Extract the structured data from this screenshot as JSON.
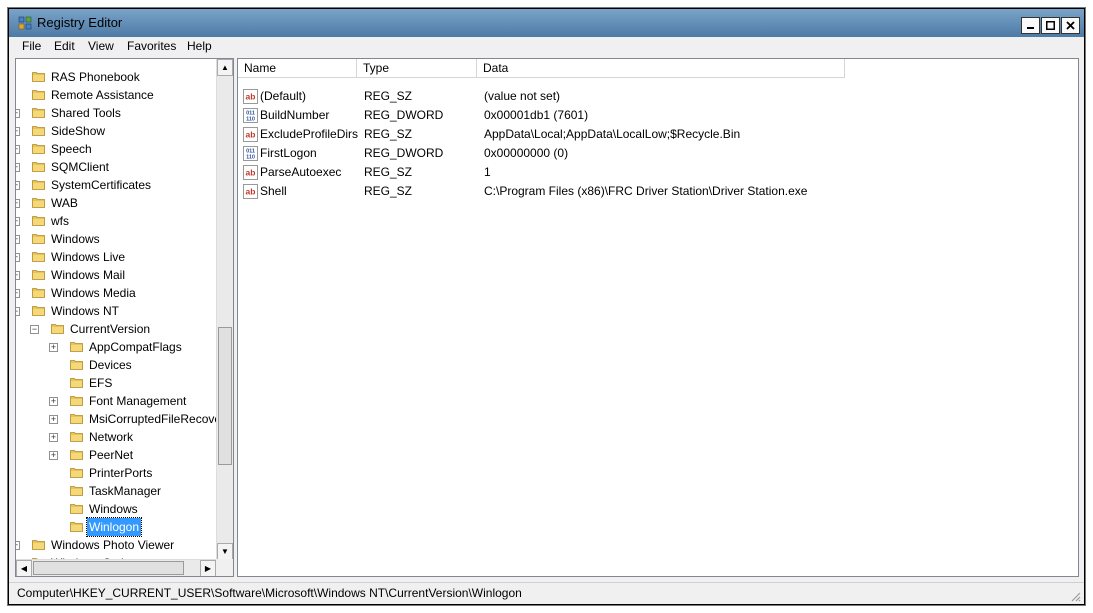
{
  "window": {
    "title": "Registry Editor"
  },
  "menu": [
    {
      "label": "File"
    },
    {
      "label": "Edit"
    },
    {
      "label": "View"
    },
    {
      "label": "Favorites"
    },
    {
      "label": "Help"
    }
  ],
  "tree": {
    "items": [
      {
        "label": "RAS Phonebook",
        "level": 1,
        "expander": ""
      },
      {
        "label": "Remote Assistance",
        "level": 1,
        "expander": ""
      },
      {
        "label": "Shared Tools",
        "level": 1,
        "expander": "plus"
      },
      {
        "label": "SideShow",
        "level": 1,
        "expander": "plus"
      },
      {
        "label": "Speech",
        "level": 1,
        "expander": "plus"
      },
      {
        "label": "SQMClient",
        "level": 1,
        "expander": "plus"
      },
      {
        "label": "SystemCertificates",
        "level": 1,
        "expander": "plus"
      },
      {
        "label": "WAB",
        "level": 1,
        "expander": "plus"
      },
      {
        "label": "wfs",
        "level": 1,
        "expander": "plus"
      },
      {
        "label": "Windows",
        "level": 1,
        "expander": "plus"
      },
      {
        "label": "Windows Live",
        "level": 1,
        "expander": "plus"
      },
      {
        "label": "Windows Mail",
        "level": 1,
        "expander": "plus"
      },
      {
        "label": "Windows Media",
        "level": 1,
        "expander": "plus"
      },
      {
        "label": "Windows NT",
        "level": 1,
        "expander": "minus"
      },
      {
        "label": "CurrentVersion",
        "level": 2,
        "expander": "minus"
      },
      {
        "label": "AppCompatFlags",
        "level": 3,
        "expander": "plus"
      },
      {
        "label": "Devices",
        "level": 3,
        "expander": ""
      },
      {
        "label": "EFS",
        "level": 3,
        "expander": ""
      },
      {
        "label": "Font Management",
        "level": 3,
        "expander": "plus"
      },
      {
        "label": "MsiCorruptedFileRecove",
        "level": 3,
        "expander": "plus"
      },
      {
        "label": "Network",
        "level": 3,
        "expander": "plus"
      },
      {
        "label": "PeerNet",
        "level": 3,
        "expander": "plus"
      },
      {
        "label": "PrinterPorts",
        "level": 3,
        "expander": ""
      },
      {
        "label": "TaskManager",
        "level": 3,
        "expander": ""
      },
      {
        "label": "Windows",
        "level": 3,
        "expander": ""
      },
      {
        "label": "Winlogon",
        "level": 3,
        "expander": "",
        "selected": true
      },
      {
        "label": "Windows Photo Viewer",
        "level": 1,
        "expander": "plus"
      },
      {
        "label": "Windows Script",
        "level": 1,
        "expander": "plus"
      }
    ]
  },
  "list": {
    "columns": [
      {
        "label": "Name"
      },
      {
        "label": "Type"
      },
      {
        "label": "Data"
      }
    ],
    "rows": [
      {
        "icon": "string-value-icon",
        "name": "(Default)",
        "type": "REG_SZ",
        "data": "(value not set)"
      },
      {
        "icon": "binary-value-icon",
        "name": "BuildNumber",
        "type": "REG_DWORD",
        "data": "0x00001db1 (7601)"
      },
      {
        "icon": "string-value-icon",
        "name": "ExcludeProfileDirs",
        "type": "REG_SZ",
        "data": "AppData\\Local;AppData\\LocalLow;$Recycle.Bin"
      },
      {
        "icon": "binary-value-icon",
        "name": "FirstLogon",
        "type": "REG_DWORD",
        "data": "0x00000000 (0)"
      },
      {
        "icon": "string-value-icon",
        "name": "ParseAutoexec",
        "type": "REG_SZ",
        "data": "1"
      },
      {
        "icon": "string-value-icon",
        "name": "Shell",
        "type": "REG_SZ",
        "data": "C:\\Program Files (x86)\\FRC Driver Station\\Driver Station.exe"
      }
    ]
  },
  "status": {
    "path": "Computer\\HKEY_CURRENT_USER\\Software\\Microsoft\\Windows NT\\CurrentVersion\\Winlogon"
  },
  "colors": {
    "selection": "#3399ff",
    "title_bar": "#6a93bb",
    "folder": "#e8c35a"
  }
}
